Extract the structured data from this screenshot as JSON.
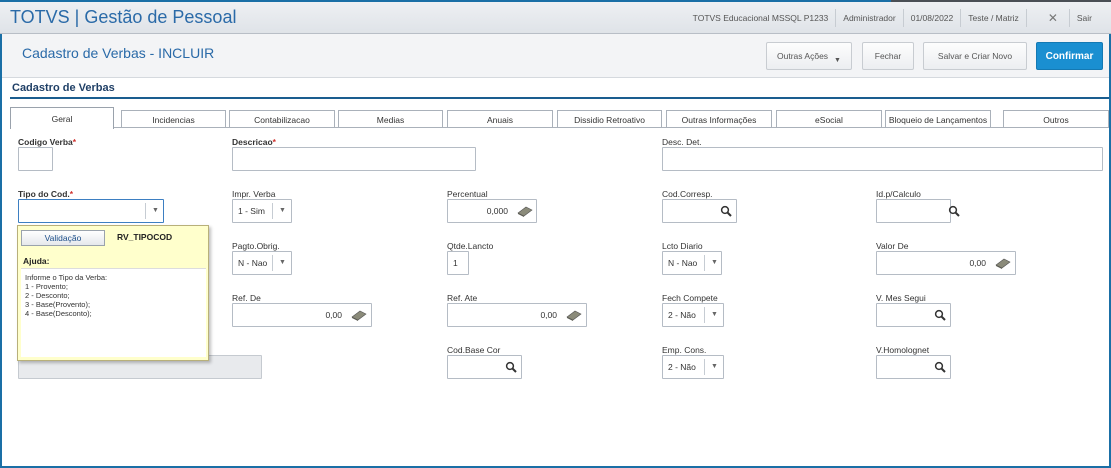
{
  "app": {
    "title": "TOTVS | Gestão de Pessoal"
  },
  "top_info": {
    "environment": "TOTVS Educacional MSSQL P1233",
    "user": "Administrador",
    "date": "01/08/2022",
    "branch": "Teste / Matriz",
    "logout": "Sair"
  },
  "header": {
    "title": "Cadastro de Verbas - INCLUIR",
    "other_actions": "Outras Ações",
    "close": "Fechar",
    "save_new": "Salvar e Criar Novo",
    "confirm": "Confirmar"
  },
  "section": {
    "title": "Cadastro de Verbas"
  },
  "tabs": [
    "Geral",
    "Incidencias",
    "Contabilizacao",
    "Medias",
    "Anuais",
    "Dissidio Retroativo",
    "Outras Informações",
    "eSocial",
    "Bloqueio de Lançamentos",
    "Outros"
  ],
  "fields": {
    "codigo_verba": {
      "label": "Codigo Verba",
      "value": ""
    },
    "descricao": {
      "label": "Descricao",
      "value": ""
    },
    "desc_det": {
      "label": "Desc. Det.",
      "value": ""
    },
    "tipo_cod": {
      "label": "Tipo do Cod.",
      "value": ""
    },
    "impr_verba": {
      "label": "Impr. Verba",
      "value": "1 - Sim"
    },
    "percentual": {
      "label": "Percentual",
      "value": "0,000"
    },
    "cod_corresp": {
      "label": "Cod.Corresp.",
      "value": ""
    },
    "id_calculo": {
      "label": "Id.p/Calculo",
      "value": ""
    },
    "pagto_obrig": {
      "label": "Pagto.Obrig.",
      "value": "N - Nao"
    },
    "qtde_lancto": {
      "label": "Qtde.Lancto",
      "value": "1"
    },
    "lcto_diario": {
      "label": "Lcto Diario",
      "value": "N - Nao"
    },
    "valor_de": {
      "label": "Valor De",
      "value": "0,00"
    },
    "ref_de": {
      "label": "Ref. De",
      "value": "0,00"
    },
    "ref_ate": {
      "label": "Ref. Ate",
      "value": "0,00"
    },
    "fech_compete": {
      "label": "Fech Compete",
      "value": "2 - Não"
    },
    "v_mes_segui": {
      "label": "V. Mes Segui",
      "value": ""
    },
    "cod_base_cor": {
      "label": "Cod.Base Cor",
      "value": ""
    },
    "emp_cons": {
      "label": "Emp. Cons.",
      "value": "2 - Não"
    },
    "v_homolognet": {
      "label": "V.Homolognet",
      "value": ""
    }
  },
  "help_popup": {
    "validation_button": "Validação",
    "field_id": "RV_TIPOCOD",
    "help_label": "Ajuda:",
    "lines": [
      "Informe o Tipo da Verba:",
      "1 - Provento;",
      "2 - Desconto;",
      "3 - Base(Provento);",
      "4 - Base(Desconto);"
    ]
  },
  "colors": {
    "accent": "#1a8fd1",
    "title_blue": "#2a6aa8",
    "required": "#d0312d",
    "help_bg": "#ffffcc"
  }
}
